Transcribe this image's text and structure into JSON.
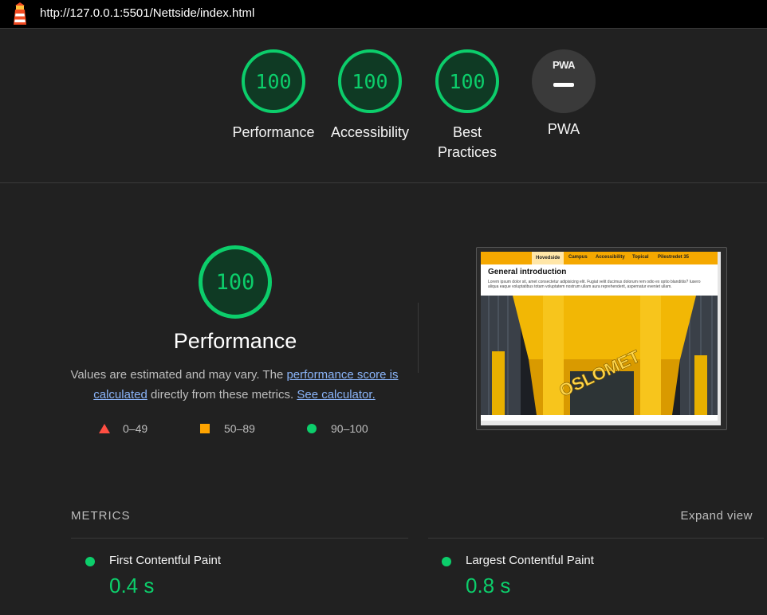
{
  "topbar": {
    "url": "http://127.0.0.1:5501/Nettside/index.html",
    "logo_icon": "lighthouse-icon"
  },
  "gauges": [
    {
      "score": "100",
      "label": "Performance"
    },
    {
      "score": "100",
      "label": "Accessibility"
    },
    {
      "score": "100",
      "label_line1": "Best",
      "label_line2": "Practices"
    },
    {
      "badge": "PWA",
      "label": "PWA"
    }
  ],
  "performance": {
    "score": "100",
    "title": "Performance",
    "desc_pre": "Values are estimated and may vary. The ",
    "link1": "performance score is calculated",
    "desc_mid": " directly from these metrics. ",
    "link2": "See calculator.",
    "legend": [
      {
        "icon": "triangle-fail-icon",
        "range": "0–49"
      },
      {
        "icon": "square-average-icon",
        "range": "50–89"
      },
      {
        "icon": "circle-pass-icon",
        "range": "90–100"
      }
    ]
  },
  "screenshot": {
    "nav": [
      "Hovedside",
      "Campus",
      "Accessibility",
      "Topical",
      "Pilestredet 35"
    ],
    "heading": "General introduction",
    "text": "Lorem ipsum dolor sit, amet consectetur adipisicing elit. Fugiat velit ducimus dolorum rem odio ex optio blanditiis? Iusero aliqua eaque voluptatibus totam voluptatem nostrum ullam aura reprehenderit, aspernatur eveniet ullam.",
    "sign": "OSLOMET"
  },
  "metrics": {
    "title": "METRICS",
    "expand": "Expand view",
    "items": [
      {
        "name": "First Contentful Paint",
        "value": "0.4 s"
      },
      {
        "name": "Largest Contentful Paint",
        "value": "0.8 s"
      }
    ]
  },
  "colors": {
    "pass": "#0cce6b",
    "average": "#ffa400",
    "fail": "#ff4e42",
    "link": "#8ab4f8",
    "background": "#212121"
  }
}
